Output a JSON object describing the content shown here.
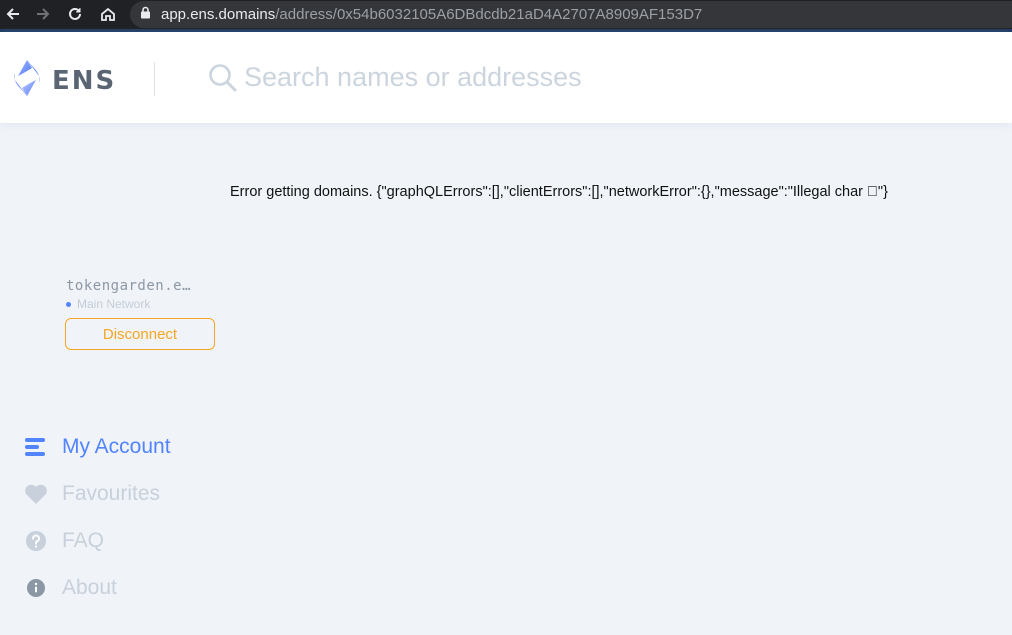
{
  "browser": {
    "url_host": "app.ens.domains",
    "url_path": "/address/0x54b6032105A6DBdcdb21aD4A2707A8909AF153D7"
  },
  "header": {
    "logo_text": "ENS",
    "search_placeholder": "Search names or addresses"
  },
  "error_message": "Error getting domains. {\"graphQLErrors\":[],\"clientErrors\":[],\"networkError\":{},\"message\":\"Illegal char \u0000\"}",
  "account": {
    "name": "tokengarden.e…",
    "network": "Main Network",
    "disconnect_label": "Disconnect"
  },
  "sidebar": {
    "items": [
      {
        "label": "My Account",
        "icon": "account-icon",
        "active": true
      },
      {
        "label": "Favourites",
        "icon": "heart-icon",
        "active": false
      },
      {
        "label": "FAQ",
        "icon": "question-icon",
        "active": false
      },
      {
        "label": "About",
        "icon": "info-icon",
        "active": false
      }
    ]
  },
  "colors": {
    "accent": "#5284ff",
    "warning": "#f5a623",
    "background": "#f0f4f9",
    "inactive_nav": "#c7d0db"
  }
}
